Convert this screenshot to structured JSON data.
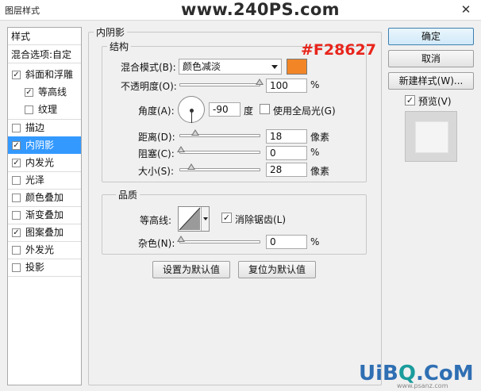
{
  "window": {
    "title": "图层样式",
    "site_text": "www.240PS.com",
    "close_glyph": "✕"
  },
  "annotation": "#F28627",
  "style_list": {
    "header": "样式",
    "blend_options": "混合选项:自定",
    "items": [
      {
        "label": "斜面和浮雕",
        "checked": true
      },
      {
        "label": "等高线",
        "checked": true
      },
      {
        "label": "纹理",
        "checked": false
      },
      {
        "label": "描边",
        "checked": false
      },
      {
        "label": "内阴影",
        "checked": true
      },
      {
        "label": "内发光",
        "checked": true
      },
      {
        "label": "光泽",
        "checked": false
      },
      {
        "label": "颜色叠加",
        "checked": false
      },
      {
        "label": "渐变叠加",
        "checked": false
      },
      {
        "label": "图案叠加",
        "checked": true
      },
      {
        "label": "外发光",
        "checked": false
      },
      {
        "label": "投影",
        "checked": false
      }
    ],
    "check_glyph": "✓"
  },
  "inner_shadow": {
    "title": "内阴影",
    "structure": {
      "title": "结构",
      "blend_mode_label": "混合模式(B):",
      "blend_mode_value": "颜色减淡",
      "color": "#f28627",
      "opacity_label": "不透明度(O):",
      "opacity_value": "100",
      "opacity_percent": 100,
      "opacity_unit": "%",
      "angle_label": "角度(A):",
      "angle_value": "-90",
      "angle_unit": "度",
      "global_light_label": "使用全局光(G)",
      "global_light_checked": false,
      "distance_label": "距离(D):",
      "distance_value": "18",
      "distance_unit": "像素",
      "choke_label": "阻塞(C):",
      "choke_value": "0",
      "choke_unit": "%",
      "size_label": "大小(S):",
      "size_value": "28",
      "size_unit": "像素"
    },
    "quality": {
      "title": "品质",
      "contour_label": "等高线:",
      "anti_alias_label": "消除锯齿(L)",
      "anti_alias_checked": true,
      "noise_label": "杂色(N):",
      "noise_value": "0",
      "noise_unit": "%"
    },
    "make_default": "设置为默认值",
    "reset_default": "复位为默认值"
  },
  "right_panel": {
    "ok": "确定",
    "cancel": "取消",
    "new_style": "新建样式(W)...",
    "preview_label": "预览(V)",
    "preview_checked": true
  },
  "watermark": {
    "part1": "UiB",
    "part2": "Q",
    "part3": ".CoM",
    "sub": "www.psanz.com"
  }
}
